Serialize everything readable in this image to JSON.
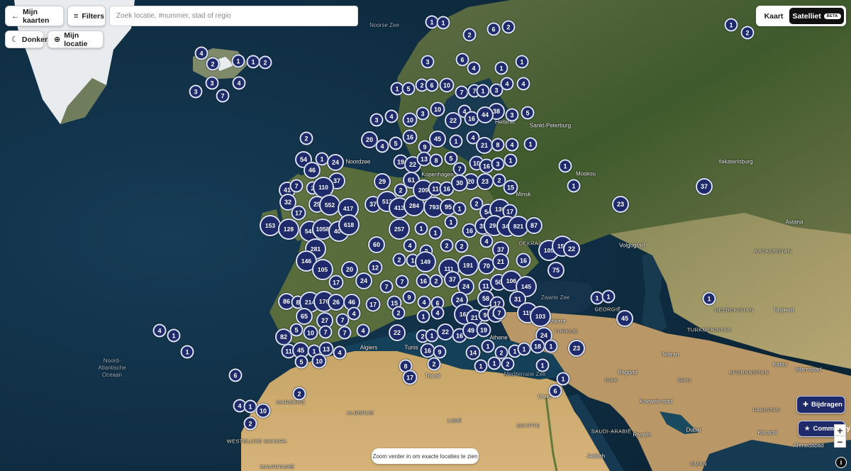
{
  "toolbar": {
    "my_maps_label": "Mijn kaarten",
    "my_maps_icon": "arrow-left-icon",
    "filters_label": "Filters",
    "filters_icon": "menu-icon",
    "search_placeholder": "Zoek locatie, #nummer, stad of regio",
    "search_value": "",
    "dark_label": "Donker",
    "dark_icon": "moon-icon",
    "location_label": "Mijn locatie",
    "location_icon": "crosshair-icon"
  },
  "layer_toggle": {
    "map_label": "Kaart",
    "satellite_label": "Satelliet",
    "beta_label": "BETA",
    "selected": "satellite"
  },
  "actions": {
    "contribute_label": "Bijdragen",
    "contribute_icon": "plus-icon",
    "community_label": "Community",
    "community_icon": "star-icon",
    "zoom_in": "+",
    "zoom_out": "−",
    "info": "i"
  },
  "hint": "Zoom verder in om exacte locaties te zien",
  "colors": {
    "cluster_fill": "#1f2a6b",
    "cluster_border": "#d9e2f5",
    "ocean": "#0d2a3f",
    "land_green": "#3d5a2a",
    "desert": "#c9a46a"
  },
  "place_labels": [
    "Noorse Zee",
    "Noordzee",
    "Kopenhagen",
    "Minsk",
    "Moskou",
    "Sankt-Peterburg",
    "Helsinki",
    "Yekaterinburg",
    "Astana",
    "KAZACHSTAN",
    "Volgograd",
    "OEKRAÏNE",
    "Zwarte Zee",
    "GEORGIË",
    "Ankara",
    "TURKIJE",
    "TURKMENISTAN",
    "Tasjkent",
    "OEZBEKISTAN",
    "Athene",
    "Tehran",
    "Bagdad",
    "IRAK",
    "IRAN",
    "AFGHANISTAN",
    "Kabul",
    "Islamabad",
    "PAKISTAN",
    "Karachi",
    "Koeweit-stad",
    "SAUDI-ARABIË",
    "Riyadh",
    "Dubai",
    "OMAN",
    "Jeddah",
    "Cairo",
    "EGYPTE",
    "LIBIË",
    "Tripoli",
    "Tunis",
    "Algiers",
    "ALGERIJE",
    "MAROKKO",
    "MAURITANIË",
    "WESTELIJKE SAHARA",
    "Mediterrane Zee",
    "Noord-Atlantische Oceaan",
    "Ahmedabad",
    "Mumbai"
  ],
  "clusters": [
    "1",
    "1",
    "2",
    "6",
    "2",
    "1",
    "2",
    "3",
    "6",
    "1",
    "4",
    "1",
    "2",
    "1",
    "2",
    "3",
    "3",
    "4",
    "7",
    "4",
    "1",
    "1",
    "5",
    "2",
    "6",
    "10",
    "7",
    "7",
    "1",
    "3",
    "4",
    "4",
    "3",
    "10",
    "4",
    "38",
    "3",
    "5",
    "3",
    "4",
    "10",
    "22",
    "16",
    "44",
    "20",
    "4",
    "5",
    "16",
    "9",
    "45",
    "1",
    "4",
    "21",
    "8",
    "4",
    "1",
    "2",
    "54",
    "1",
    "24",
    "46",
    "37",
    "19",
    "22",
    "13",
    "8",
    "5",
    "7",
    "10",
    "16",
    "3",
    "1",
    "3",
    "29",
    "41",
    "7",
    "2",
    "110",
    "61",
    "20",
    "23",
    "2",
    "15",
    "1",
    "1",
    "37",
    "23",
    "32",
    "29",
    "552",
    "417",
    "37",
    "513",
    "413",
    "284",
    "793",
    "95",
    "1",
    "2",
    "54",
    "130",
    "17",
    "17",
    "2",
    "209",
    "11",
    "16",
    "30",
    "153",
    "128",
    "545",
    "1058",
    "406",
    "618",
    "257",
    "1",
    "1",
    "1",
    "16",
    "39",
    "294",
    "344",
    "821",
    "87",
    "281",
    "60",
    "4",
    "2",
    "2",
    "2",
    "4",
    "37",
    "105",
    "153",
    "22",
    "16",
    "146",
    "105",
    "20",
    "12",
    "2",
    "1",
    "149",
    "111",
    "191",
    "70",
    "21",
    "75",
    "17",
    "24",
    "7",
    "7",
    "16",
    "2",
    "37",
    "24",
    "11",
    "50",
    "106",
    "145",
    "86",
    "8",
    "214",
    "176",
    "26",
    "46",
    "17",
    "15",
    "9",
    "4",
    "6",
    "24",
    "58",
    "17",
    "31",
    "119",
    "103",
    "65",
    "27",
    "7",
    "4",
    "2",
    "1",
    "4",
    "161",
    "21",
    "9",
    "22",
    "7",
    "45",
    "82",
    "5",
    "10",
    "7",
    "7",
    "4",
    "22",
    "2",
    "1",
    "22",
    "16",
    "49",
    "19",
    "24",
    "11",
    "45",
    "1",
    "13",
    "4",
    "16",
    "9",
    "14",
    "1",
    "2",
    "1",
    "1",
    "18",
    "1",
    "23",
    "5",
    "10",
    "8",
    "2",
    "1",
    "1",
    "2",
    "1",
    "1",
    "17",
    "6",
    "2",
    "4",
    "1",
    "10",
    "2",
    "1",
    "1",
    "4",
    "6",
    "1",
    "1",
    "1"
  ]
}
